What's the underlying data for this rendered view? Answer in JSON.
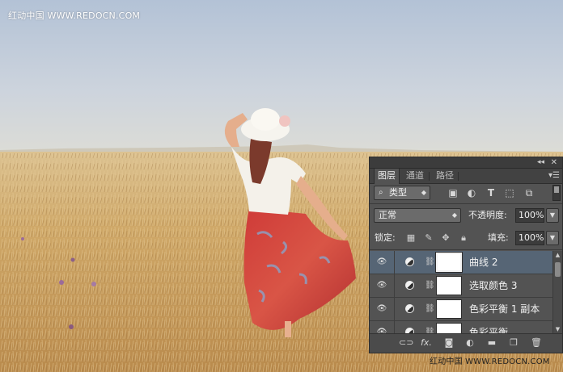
{
  "watermark": {
    "top": "红动中国 WWW.REDOCN.COM",
    "bottom": "红动中国 WWW.REDOCN.COM"
  },
  "panel": {
    "tabs": [
      {
        "label": "图层",
        "active": true
      },
      {
        "label": "通道",
        "active": false
      },
      {
        "label": "路径",
        "active": false
      }
    ],
    "filter": {
      "label": "类型",
      "icon": "search-icon"
    },
    "blend_mode": "正常",
    "opacity_label": "不透明度:",
    "opacity_value": "100%",
    "lock_label": "锁定:",
    "fill_label": "填充:",
    "fill_value": "100%",
    "layers": [
      {
        "name": "曲线 2",
        "selected": true
      },
      {
        "name": "选取颜色 3",
        "selected": false
      },
      {
        "name": "色彩平衡 1 副本",
        "selected": false
      },
      {
        "name": "色彩平衡",
        "selected": false
      }
    ],
    "footer_fx": "fx."
  },
  "colors": {
    "panel_bg": "#535353",
    "selected_row": "#566575",
    "sky": "#c3ccd8",
    "field": "#c9a468"
  }
}
